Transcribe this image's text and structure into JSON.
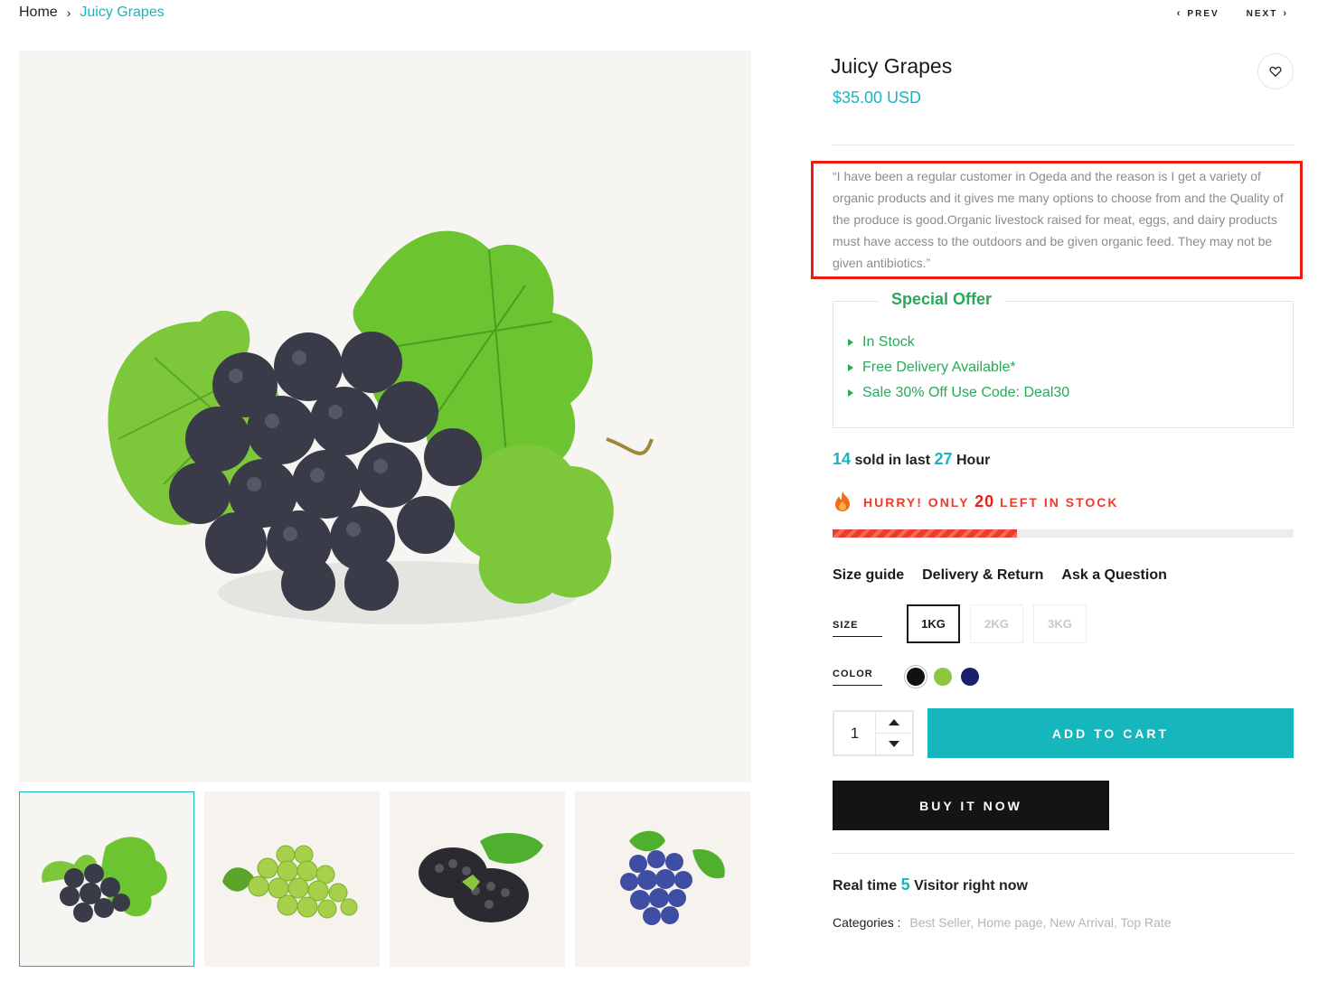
{
  "breadcrumb": {
    "home": "Home",
    "separator": "›",
    "current": "Juicy Grapes"
  },
  "nav": {
    "prev": "PREV",
    "next": "NEXT"
  },
  "product": {
    "title": "Juicy Grapes",
    "price": "$35.00 USD",
    "description": "“I have been a regular customer in Ogeda and the reason is I get a variety of organic products and it gives me many options to choose from and the Quality of the produce is good.Organic livestock raised for meat, eggs, and dairy products must have access to the outdoors and be given organic feed. They may not be given antibiotics.”"
  },
  "special_offer": {
    "title": "Special Offer",
    "items": [
      "In Stock",
      "Free Delivery Available*",
      "Sale 30% Off Use Code: Deal30"
    ]
  },
  "sold": {
    "count": "14",
    "mid": "sold in last",
    "hours": "27",
    "suffix": "Hour"
  },
  "stock": {
    "prefix": "HURRY! ONLY",
    "count": "20",
    "suffix": "LEFT IN STOCK",
    "progress_fraction": 0.4
  },
  "info_links": [
    "Size guide",
    "Delivery & Return",
    "Ask a Question"
  ],
  "size": {
    "label": "SIZE",
    "options": [
      "1KG",
      "2KG",
      "3KG"
    ],
    "selected": "1KG"
  },
  "color": {
    "label": "COLOR",
    "options": [
      "#111111",
      "#8cc63f",
      "#1c1f6b"
    ]
  },
  "quantity": "1",
  "buttons": {
    "add_to_cart": "ADD TO CART",
    "buy_now": "BUY IT NOW"
  },
  "visitors": {
    "prefix": "Real time",
    "count": "5",
    "suffix": "Visitor right now"
  },
  "categories": {
    "label": "Categories :",
    "list": "Best Seller,  Home page,  New Arrival,  Top Rate"
  },
  "colors": {
    "accent": "#15b7bd",
    "offer_green": "#29a859",
    "alert_red": "#ee1d10",
    "highlight_box": "#ee1d10"
  },
  "icons": [
    "chevron-right-icon",
    "chevron-left-icon",
    "heart-icon",
    "caret-up-icon",
    "caret-down-icon",
    "fire-icon"
  ]
}
